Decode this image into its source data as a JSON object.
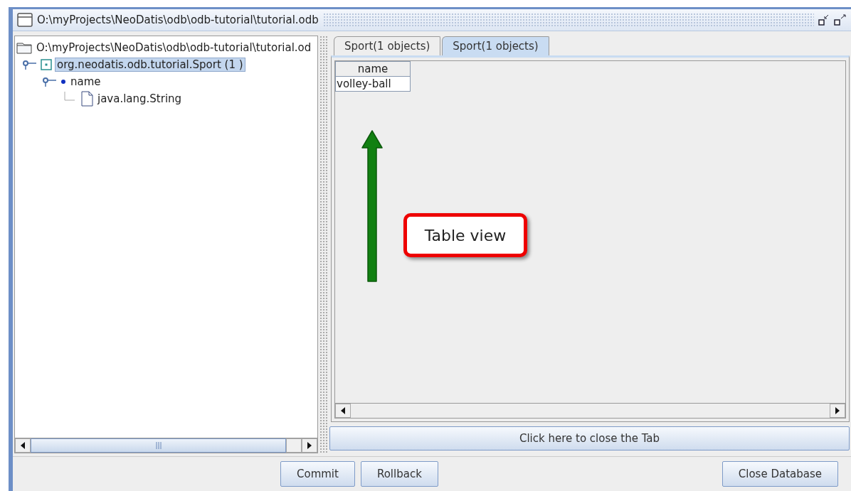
{
  "window": {
    "title": "O:\\myProjects\\NeoDatis\\odb\\odb-tutorial\\tutorial.odb"
  },
  "tree": [
    {
      "label": "O:\\myProjects\\NeoDatis\\odb\\odb-tutorial\\tutorial.od",
      "kind": "folder",
      "selected": false,
      "children": [
        {
          "label": "org.neodatis.odb.tutorial.Sport (1 )",
          "kind": "class",
          "selected": true,
          "children": [
            {
              "label": "name",
              "kind": "field",
              "selected": false,
              "children": [
                {
                  "label": "java.lang.String",
                  "kind": "file",
                  "selected": false
                }
              ]
            }
          ]
        }
      ]
    }
  ],
  "tabs": [
    {
      "label": "Sport(1 objects)",
      "selected": false
    },
    {
      "label": "Sport(1 objects)",
      "selected": true
    }
  ],
  "table": {
    "columns": [
      "name"
    ],
    "rows": [
      [
        "volley-ball"
      ]
    ]
  },
  "close_tab_button": "Click here to close the Tab",
  "annotation": {
    "text": "Table view"
  },
  "buttons": [
    "Commit",
    "Rollback"
  ],
  "close_database_button": "Close Database"
}
